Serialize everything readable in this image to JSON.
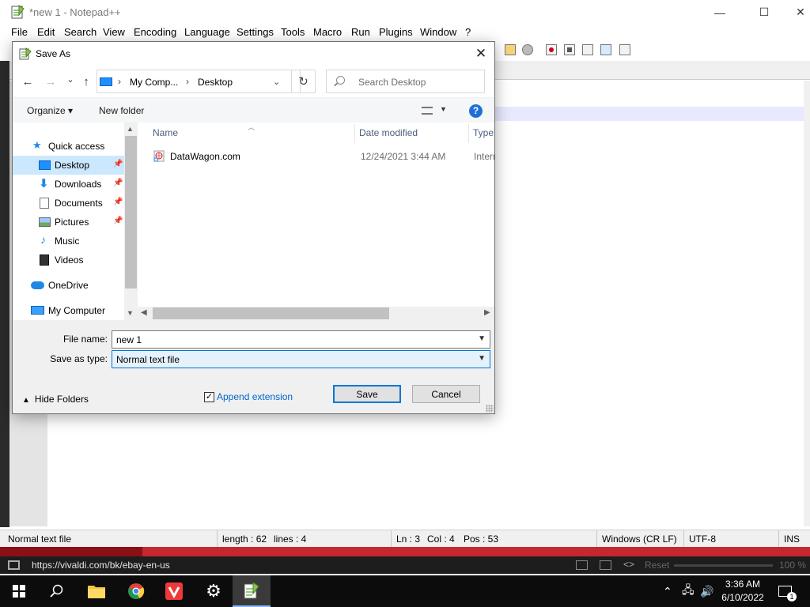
{
  "npp": {
    "title": "*new 1 - Notepad++",
    "menu": [
      "File",
      "Edit",
      "Search",
      "View",
      "Encoding",
      "Language",
      "Settings",
      "Tools",
      "Macro",
      "Run",
      "Plugins",
      "Window",
      "?"
    ],
    "window_controls": {
      "minimize": "—",
      "maximize": "☐",
      "close": "✕"
    },
    "status": {
      "type": "Normal text file",
      "length": "length : 62",
      "lines": "lines : 4",
      "ln": "Ln : 3",
      "col": "Col : 4",
      "pos": "Pos : 53",
      "eol": "Windows (CR LF)",
      "encoding": "UTF-8",
      "mode": "INS"
    }
  },
  "dialog": {
    "title": "Save As",
    "close_glyph": "✕",
    "nav": {
      "back": "←",
      "forward": "→",
      "recent": "⌄",
      "up": "↑",
      "refresh": "↻"
    },
    "address": {
      "crumb1": "My Comp...",
      "crumb2": "Desktop",
      "sep": "›",
      "dropdown": "⌄"
    },
    "search_placeholder": "Search Desktop",
    "organize": "Organize ▾",
    "new_folder": "New folder",
    "help": "?",
    "sidebar": {
      "quick_access": "Quick access",
      "items": [
        {
          "label": "Desktop",
          "pinned": true,
          "selected": true
        },
        {
          "label": "Downloads",
          "pinned": true
        },
        {
          "label": "Documents",
          "pinned": true
        },
        {
          "label": "Pictures",
          "pinned": true
        },
        {
          "label": "Music"
        },
        {
          "label": "Videos"
        }
      ],
      "onedrive": "OneDrive",
      "computer": "My Computer"
    },
    "columns": {
      "name": "Name",
      "date": "Date modified",
      "type": "Type"
    },
    "files": [
      {
        "name": "DataWagon.com",
        "date": "12/24/2021 3:44 AM",
        "type": "Intern"
      }
    ],
    "file_name_label": "File name:",
    "file_name_value": "new 1",
    "save_type_label": "Save as type:",
    "save_type_value": "Normal text file",
    "hide_folders": "Hide Folders",
    "append_extension": "Append extension",
    "append_checked": "✓",
    "save_label": "Save",
    "cancel_label": "Cancel"
  },
  "vivaldi": {
    "url": "https://vivaldi.com/bk/ebay-en-us",
    "reset": "Reset",
    "zoom": "100 %"
  },
  "taskbar": {
    "time": "3:36 AM",
    "date": "6/10/2022",
    "notifications": "1"
  },
  "colors": {
    "accent": "#0078d7",
    "selection": "#cce8ff",
    "vivaldi_red": "#c6262e",
    "taskbar": "#0c0c0c"
  }
}
